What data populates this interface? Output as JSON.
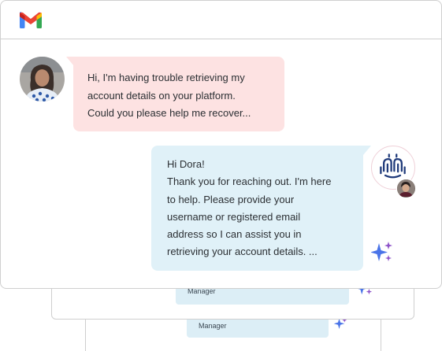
{
  "app": {
    "logo_icon": "gmail-logo-icon",
    "colors": {
      "incoming_bubble": "#fde2e2",
      "outgoing_bubble": "#e0f1f8",
      "ghost_bubble": "#dceef6",
      "bot_logo": "#1f3a7a",
      "sparkle_blue": "#4a74e8",
      "sparkle_purple": "#8e54c9"
    }
  },
  "conversation": {
    "incoming": {
      "avatar_icon": "customer-avatar",
      "lines": [
        "Hi, I'm having trouble retrieving my",
        "account details on your platform.",
        "Could you please help me recover..."
      ]
    },
    "outgoing": {
      "bot_avatar_icon": "bot-logo-icon",
      "agent_avatar_icon": "agent-avatar",
      "lines": [
        "Hi Dora!",
        "Thank you for reaching out. I'm here",
        "to help. Please provide your",
        "username or registered email",
        "address so I can assist you in",
        "retrieving your account details.   ..."
      ]
    },
    "ai_indicator_icon": "ai-sparkle-icon"
  },
  "stacked_cards": [
    {
      "label": "Manager"
    },
    {
      "label": "Manager"
    }
  ]
}
